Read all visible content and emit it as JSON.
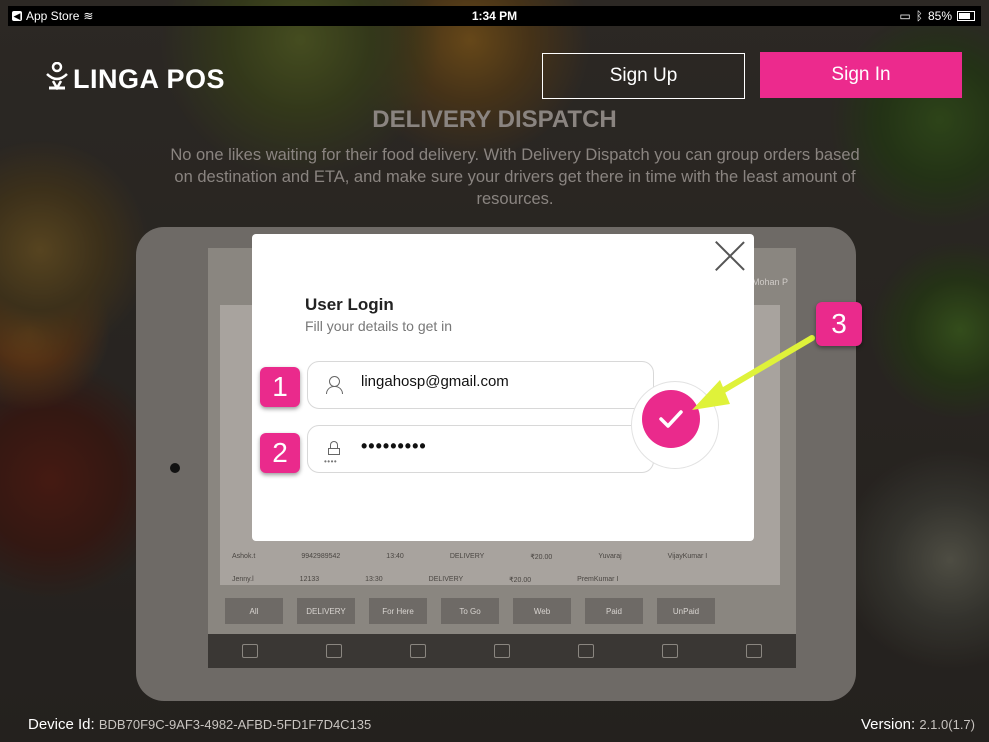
{
  "status_bar": {
    "back_app": "App Store",
    "time": "1:34 PM",
    "battery": "85%"
  },
  "header": {
    "logo_text": "LINGA POS",
    "sign_up_label": "Sign Up",
    "sign_in_label": "Sign In"
  },
  "feature": {
    "title": "DELIVERY DISPATCH",
    "description": "No one likes waiting for their food delivery. With Delivery Dispatch you can group orders based on destination and ETA, and make sure your drivers get there in time with the least amount of resources."
  },
  "background_ipad": {
    "rows": [
      {
        "name": "Ashok.t",
        "phone": "9942989542",
        "time": "13:40",
        "type": "DELIVERY",
        "amount": "₹20.00",
        "driver": "Yuvaraj",
        "server": "VijayKumar I"
      },
      {
        "name": "Jenny.l",
        "phone": "12133",
        "time": "13:30",
        "type": "DELIVERY",
        "amount": "₹20.00",
        "driver": "",
        "server": "PremKumar I"
      }
    ],
    "filters": [
      "All",
      "DELIVERY",
      "For Here",
      "To Go",
      "Web",
      "Paid",
      "UnPaid"
    ],
    "user": "Mohan P"
  },
  "login": {
    "title": "User Login",
    "subtitle": "Fill your details to get in",
    "email_value": "lingahosp@gmail.com",
    "password_value": "•••••••••",
    "lock_dots": "••••"
  },
  "annotations": {
    "badge1": "1",
    "badge2": "2",
    "badge3": "3"
  },
  "footer": {
    "device_label": "Device Id:",
    "device_id": "BDB70F9C-9AF3-4982-AFBD-5FD1F7D4C135",
    "version_label": "Version:",
    "version_value": "2.1.0(1.7)"
  },
  "colors": {
    "accent": "#ec2a8d",
    "arrow": "#dff23a"
  }
}
